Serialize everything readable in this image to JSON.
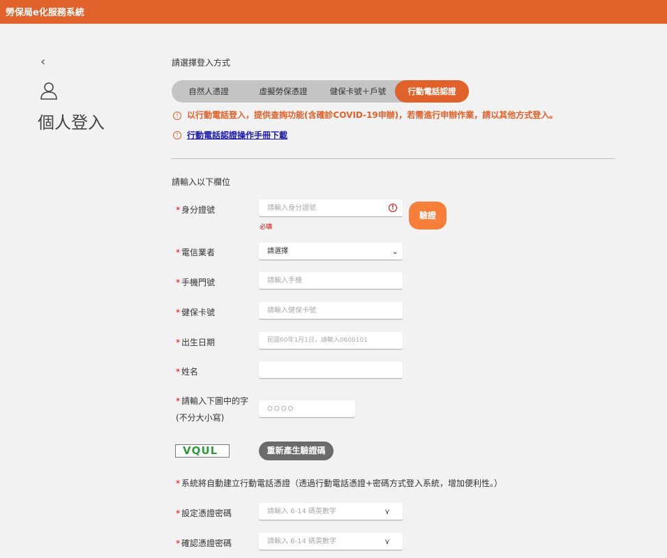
{
  "header": {
    "title": "勞保局e化服務系統"
  },
  "page": {
    "back_icon": "‹",
    "title": "個人登入"
  },
  "login_method": {
    "label": "請選擇登入方式",
    "tabs": [
      "自然人憑證",
      "虛擬勞保憑證",
      "健保卡號＋戶號",
      "行動電話認證"
    ],
    "active": 3
  },
  "notice": {
    "message": "以行動電話登入，提供查詢功能(含確診COVID-19申辦)，若需進行申辦作業，請以其他方式登入。",
    "manual_link": "行動電話認證操作手冊下載"
  },
  "form": {
    "section_label": "請輸入以下欄位",
    "id": {
      "label": "身分證號",
      "placeholder": "請輸入身分證號",
      "error": "必填",
      "verify_button": "驗證"
    },
    "carrier": {
      "label": "電信業者",
      "value": "請選擇"
    },
    "phone": {
      "label": "手機門號",
      "placeholder": "請輸入手機"
    },
    "nhi": {
      "label": "健保卡號",
      "placeholder": "請輸入健保卡號"
    },
    "birth": {
      "label": "出生日期",
      "placeholder": "民國60年1月1日，請輸入0600101"
    },
    "name": {
      "label": "姓名",
      "placeholder": ""
    },
    "captcha": {
      "label": "請輸入下圖中的字",
      "sublabel": "(不分大小寫)",
      "placeholder": "OOOO",
      "image_text": "VQUL",
      "regen_button": "重新產生驗證碼"
    },
    "auto_notice": "系統將自動建立行動電話憑證（透過行動電話憑證+密碼方式登入系統，增加便利性。）",
    "password": {
      "label": "設定憑證密碼",
      "placeholder": "請輸入 6-14 碼英數字"
    },
    "confirm": {
      "label": "確認憑證密碼",
      "placeholder": "請輸入 6-14 碼英數字"
    },
    "required_mark": "*"
  },
  "colors": {
    "brand": "#e0612a",
    "verify": "#f77f3a",
    "regen": "#6b6b6b"
  }
}
